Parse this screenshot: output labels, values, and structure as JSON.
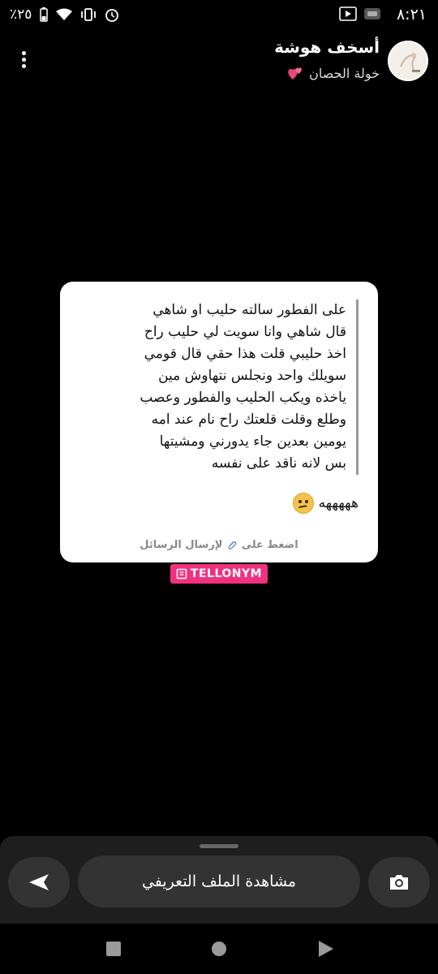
{
  "status_bar": {
    "time": "٨:٢١",
    "battery": "٪٢٥"
  },
  "header": {
    "username": "أسخف هوشة",
    "subtitle": "خولة الحصان",
    "subtitle_icon": "two-hearts-icon",
    "avatar_icon": "avatar-image"
  },
  "card": {
    "message": "على الفطور سالته حليب او شاهي\nقال شاهي وانا سويت لي حليب راح\nاخذ حليبي قلت هذا حقي قال قومي\nسويلك واحد ونجلس نتهاوش مين\nياخذه ويكب الحليب والفطور وعصب\nوطلع وقلت قلعتك راح نام عند امه\nيومين بعدين جاء يدورني ومشيتها\nبس لانه ناقد على نفسه",
    "reply": "هههههه",
    "reply_emoji": "woozy-face-icon",
    "hint_before": "اضغط على",
    "hint_after": "لإرسال الرسائل",
    "hint_icon": "paperclip-icon"
  },
  "brand": {
    "label": "TELLONYM",
    "color": "#f0317f"
  },
  "bottom_sheet": {
    "profile_button_label": "مشاهدة الملف التعريفي",
    "send_icon": "send-arrow-icon",
    "camera_icon": "camera-icon"
  }
}
